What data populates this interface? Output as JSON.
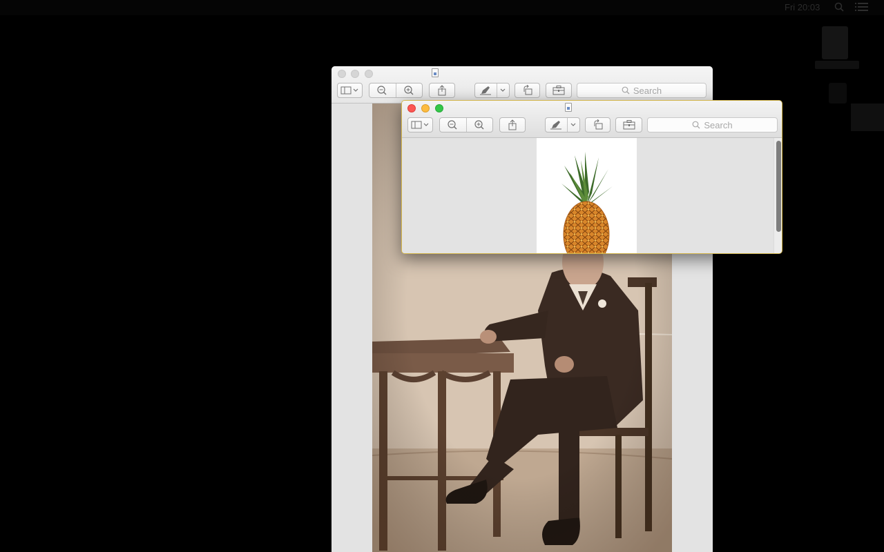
{
  "menubar": {
    "clock": "Fri 20:03",
    "search_icon": "spotlight-search-icon",
    "list_icon": "notification-center-icon"
  },
  "back_window": {
    "search_placeholder": "Search",
    "image": "vintage sepia photograph of a seated man in a suit at a table"
  },
  "front_window": {
    "search_placeholder": "Search",
    "image": "pineapple on white background"
  },
  "colors": {
    "close": "#fc5753",
    "minimize": "#fdbc40",
    "zoom": "#33c748",
    "inactive": "#d6d6d6"
  }
}
